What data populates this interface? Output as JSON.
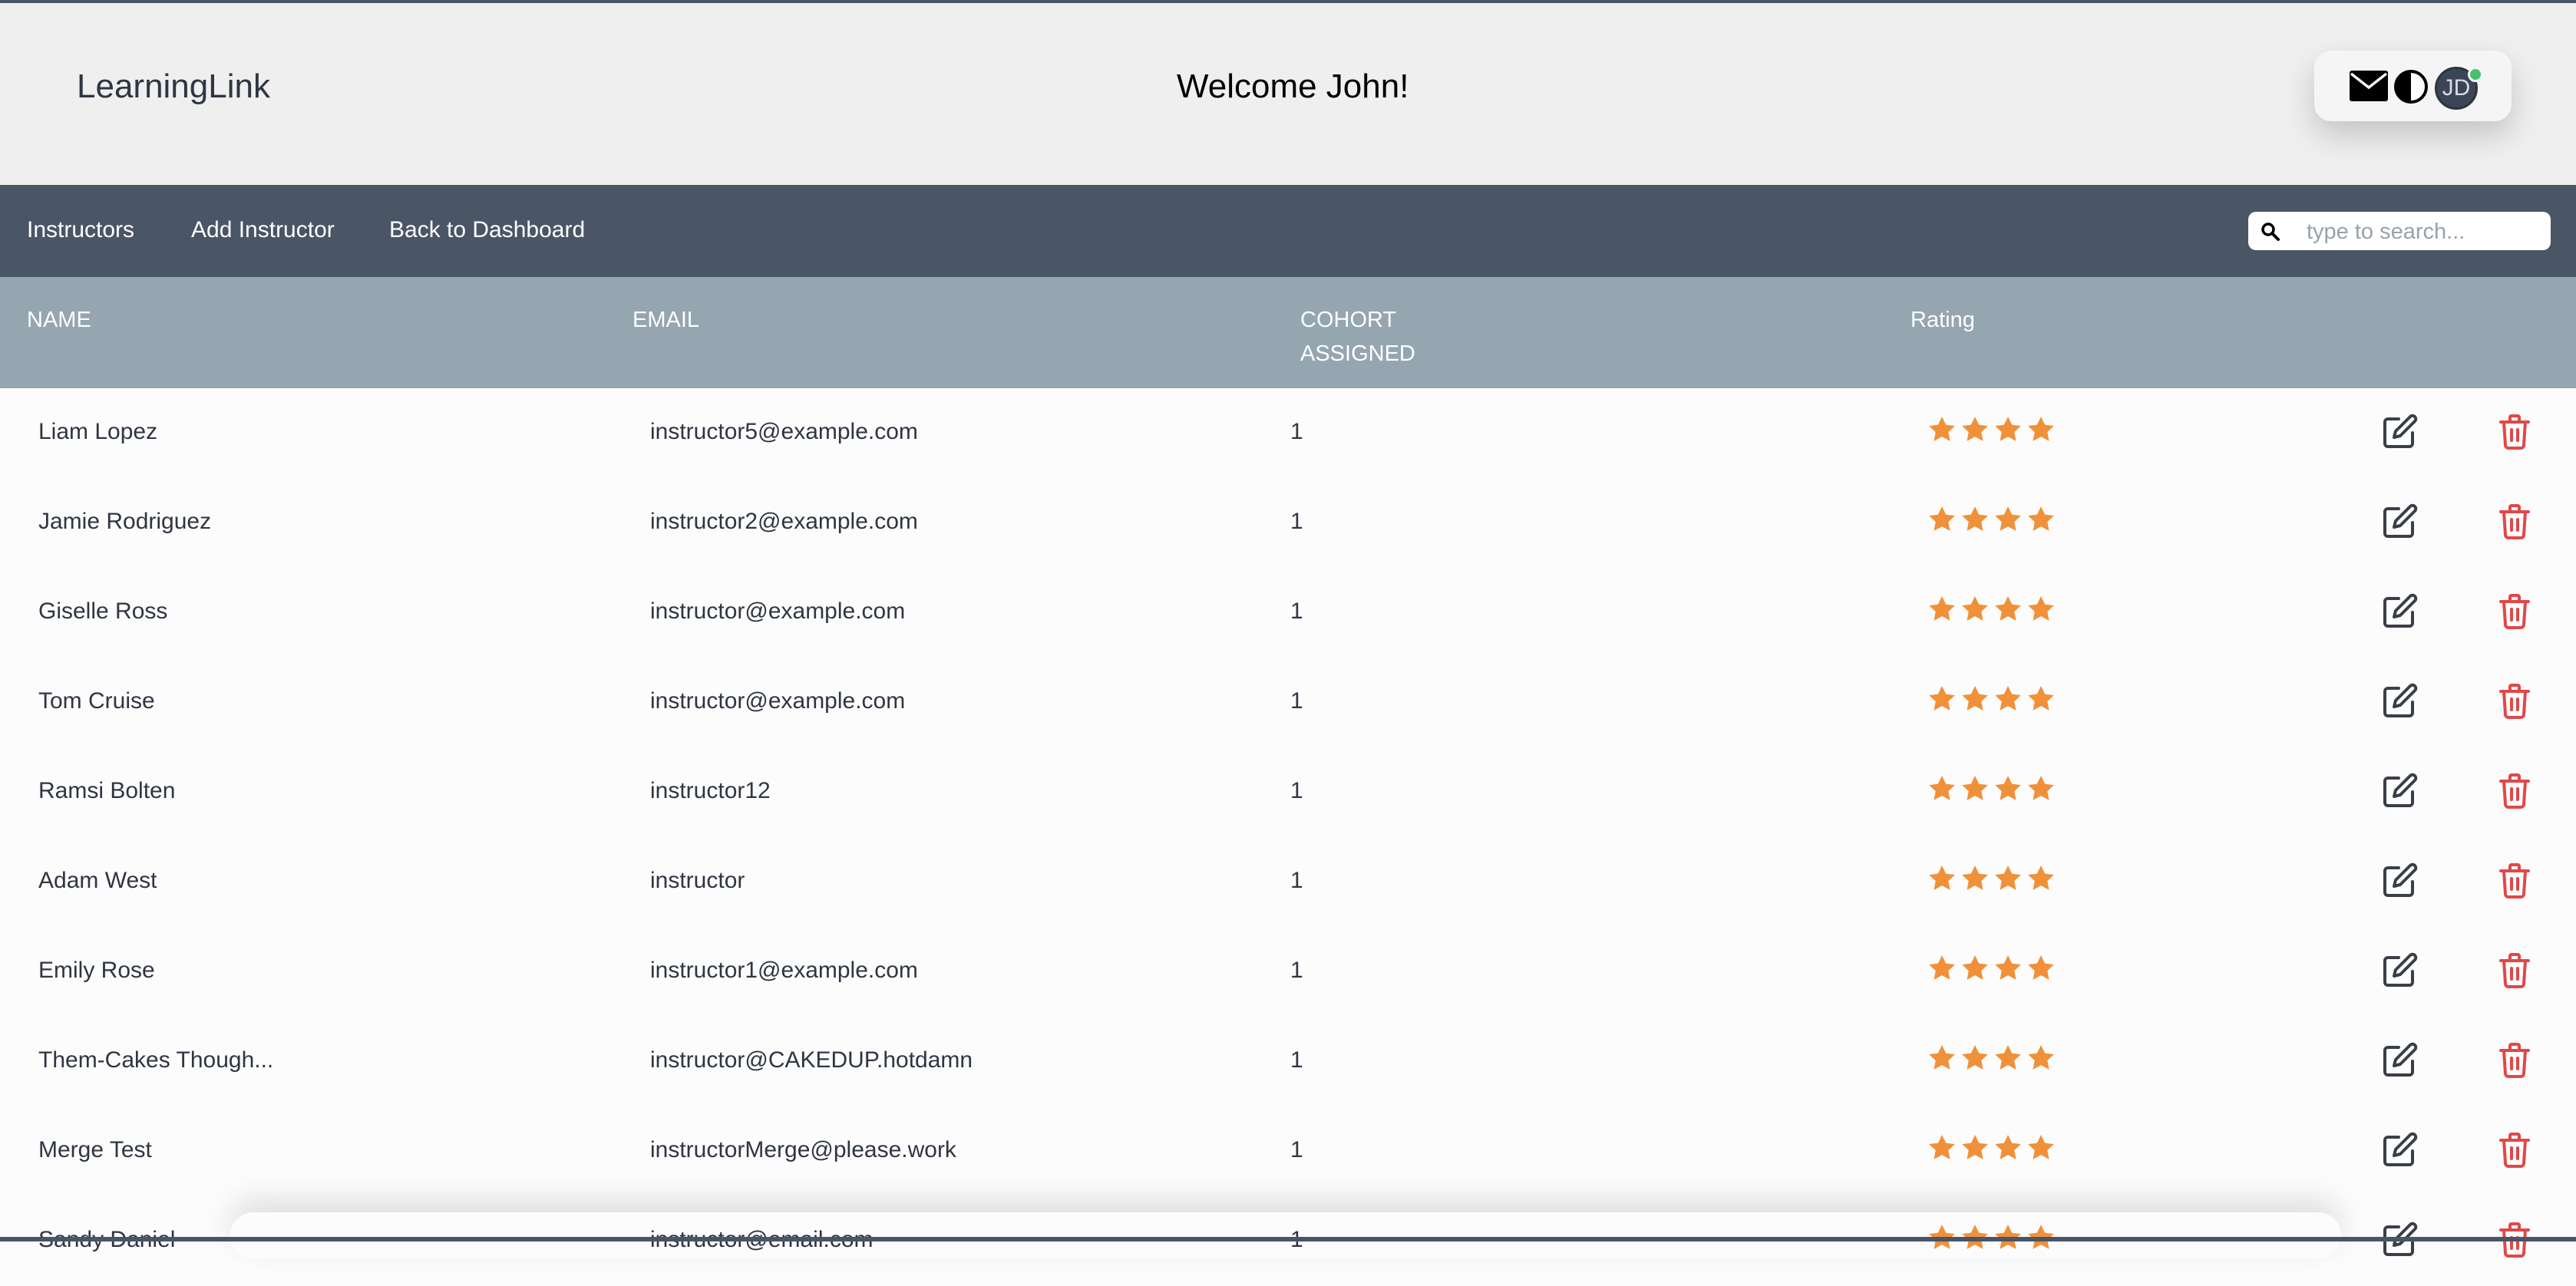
{
  "header": {
    "brand": "LearningLink",
    "welcome": "Welcome John!",
    "avatar_initials": "JD"
  },
  "nav": {
    "items": [
      {
        "label": "Instructors"
      },
      {
        "label": "Add Instructor"
      },
      {
        "label": "Back to Dashboard"
      }
    ],
    "search_placeholder": "type to search..."
  },
  "table": {
    "columns": [
      "NAME",
      "EMAIL",
      "COHORT\nASSIGNED",
      "Rating"
    ],
    "rows": [
      {
        "name": "Liam Lopez",
        "email": "instructor5@example.com",
        "cohort": "1",
        "rating": 4
      },
      {
        "name": "Jamie Rodriguez",
        "email": "instructor2@example.com",
        "cohort": "1",
        "rating": 4
      },
      {
        "name": "Giselle Ross",
        "email": "instructor@example.com",
        "cohort": "1",
        "rating": 4
      },
      {
        "name": "Tom Cruise",
        "email": "instructor@example.com",
        "cohort": "1",
        "rating": 4
      },
      {
        "name": "Ramsi Bolten",
        "email": "instructor12",
        "cohort": "1",
        "rating": 4
      },
      {
        "name": "Adam West",
        "email": "instructor",
        "cohort": "1",
        "rating": 4
      },
      {
        "name": "Emily Rose",
        "email": "instructor1@example.com",
        "cohort": "1",
        "rating": 4
      },
      {
        "name": "Them-Cakes Though...",
        "email": "instructor@CAKEDUP.hotdamn",
        "cohort": "1",
        "rating": 4
      },
      {
        "name": "Merge Test",
        "email": "instructorMerge@please.work",
        "cohort": "1",
        "rating": 4
      },
      {
        "name": "Sandy Daniel",
        "email": "instructor@email.com",
        "cohort": "1",
        "rating": 4
      }
    ]
  },
  "icons": {
    "mail": "envelope-icon",
    "theme": "contrast-icon",
    "search": "search-icon",
    "edit": "edit-icon",
    "delete": "trash-icon",
    "star": "star-icon"
  },
  "colors": {
    "navbar": "#4a5566",
    "table_header": "#95a6b1",
    "star": "#f0913a",
    "delete": "#e04848",
    "edit": "#3a3f47"
  }
}
